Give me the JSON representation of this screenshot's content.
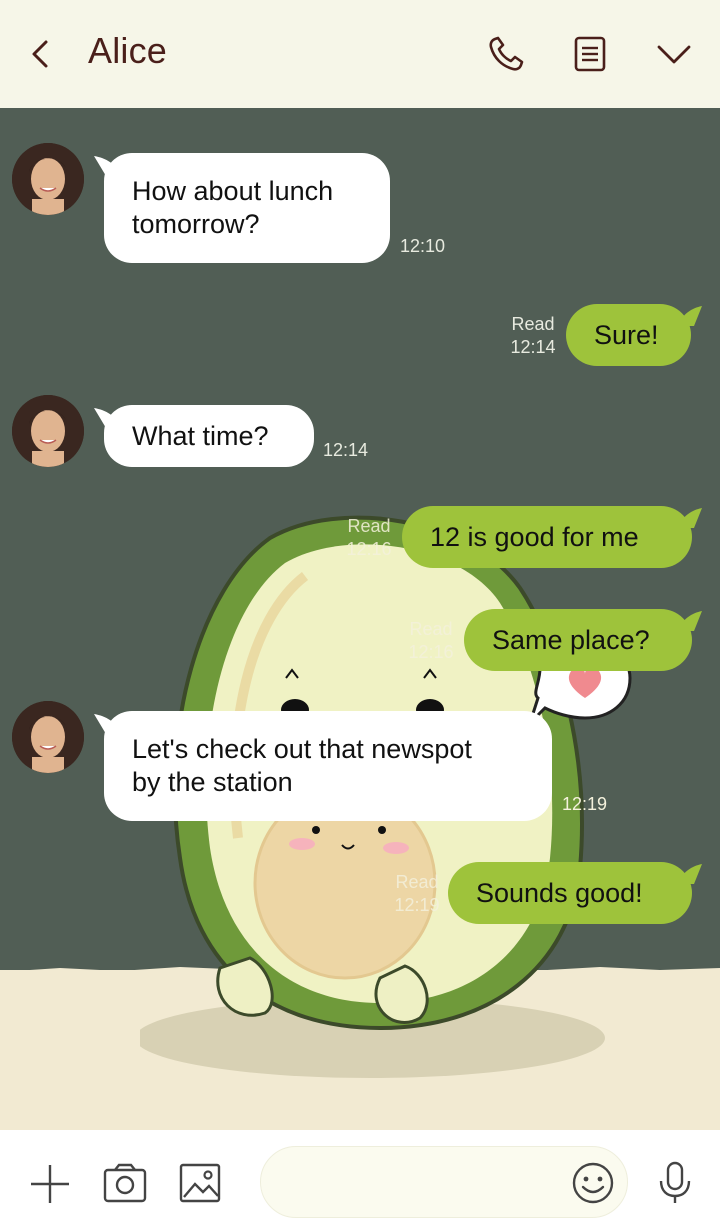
{
  "header": {
    "title": "Alice",
    "icons": [
      "back-chevron-icon",
      "phone-icon",
      "notes-icon",
      "chevron-down-icon"
    ]
  },
  "messages": [
    {
      "side": "in",
      "text_line1": "How about lunch",
      "text_line2": "tomorrow?",
      "time": "12:10"
    },
    {
      "side": "out",
      "text": "Sure!",
      "read": "Read",
      "time": "12:14"
    },
    {
      "side": "in",
      "text": "What time?",
      "time": "12:14"
    },
    {
      "side": "out",
      "text": "12 is good for me",
      "read": "Read",
      "time": "12:16"
    },
    {
      "side": "out",
      "text": "Same place?",
      "read": "Read",
      "time": "12:16"
    },
    {
      "side": "in",
      "text_line1": "Let's check out that newspot",
      "text_line2": "by the station",
      "time": "12:19"
    },
    {
      "side": "out",
      "text": "Sounds good!",
      "read": "Read",
      "time": "12:19"
    }
  ],
  "bottom_bar": {
    "icons": [
      "plus-icon",
      "camera-icon",
      "image-icon",
      "emoji-icon",
      "microphone-icon"
    ],
    "input_value": ""
  },
  "colors": {
    "header_bg": "#f6f6e8",
    "chat_bg": "#515e55",
    "outgoing_bubble": "#9ec33b",
    "incoming_bubble": "#ffffff",
    "title": "#4a1f1a"
  }
}
